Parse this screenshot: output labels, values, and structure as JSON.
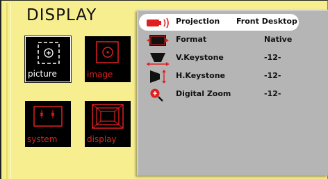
{
  "menu": {
    "title": "DISPLAY",
    "tiles": [
      {
        "label": "picture",
        "icon": "picture-icon",
        "selected": true
      },
      {
        "label": "image",
        "icon": "image-icon",
        "selected": false
      },
      {
        "label": "system",
        "icon": "system-icon",
        "selected": false
      },
      {
        "label": "display",
        "icon": "display-icon",
        "selected": false
      }
    ]
  },
  "settings": {
    "items": [
      {
        "label": "Projection",
        "value": "Front Desktop",
        "icon": "projection-icon",
        "highlighted": true
      },
      {
        "label": "Format",
        "value": "Native",
        "icon": "format-icon"
      },
      {
        "label": "V.Keystone",
        "value": "-12-",
        "icon": "v-keystone-icon"
      },
      {
        "label": "H.Keystone",
        "value": "-12-",
        "icon": "h-keystone-icon"
      },
      {
        "label": "Digital Zoom",
        "value": "-12-",
        "icon": "digital-zoom-icon"
      }
    ]
  },
  "colors": {
    "background": "#f7ef8f",
    "panel": "#b5b5b5",
    "accent_red": "#e02020",
    "tile_bg": "#000000"
  }
}
